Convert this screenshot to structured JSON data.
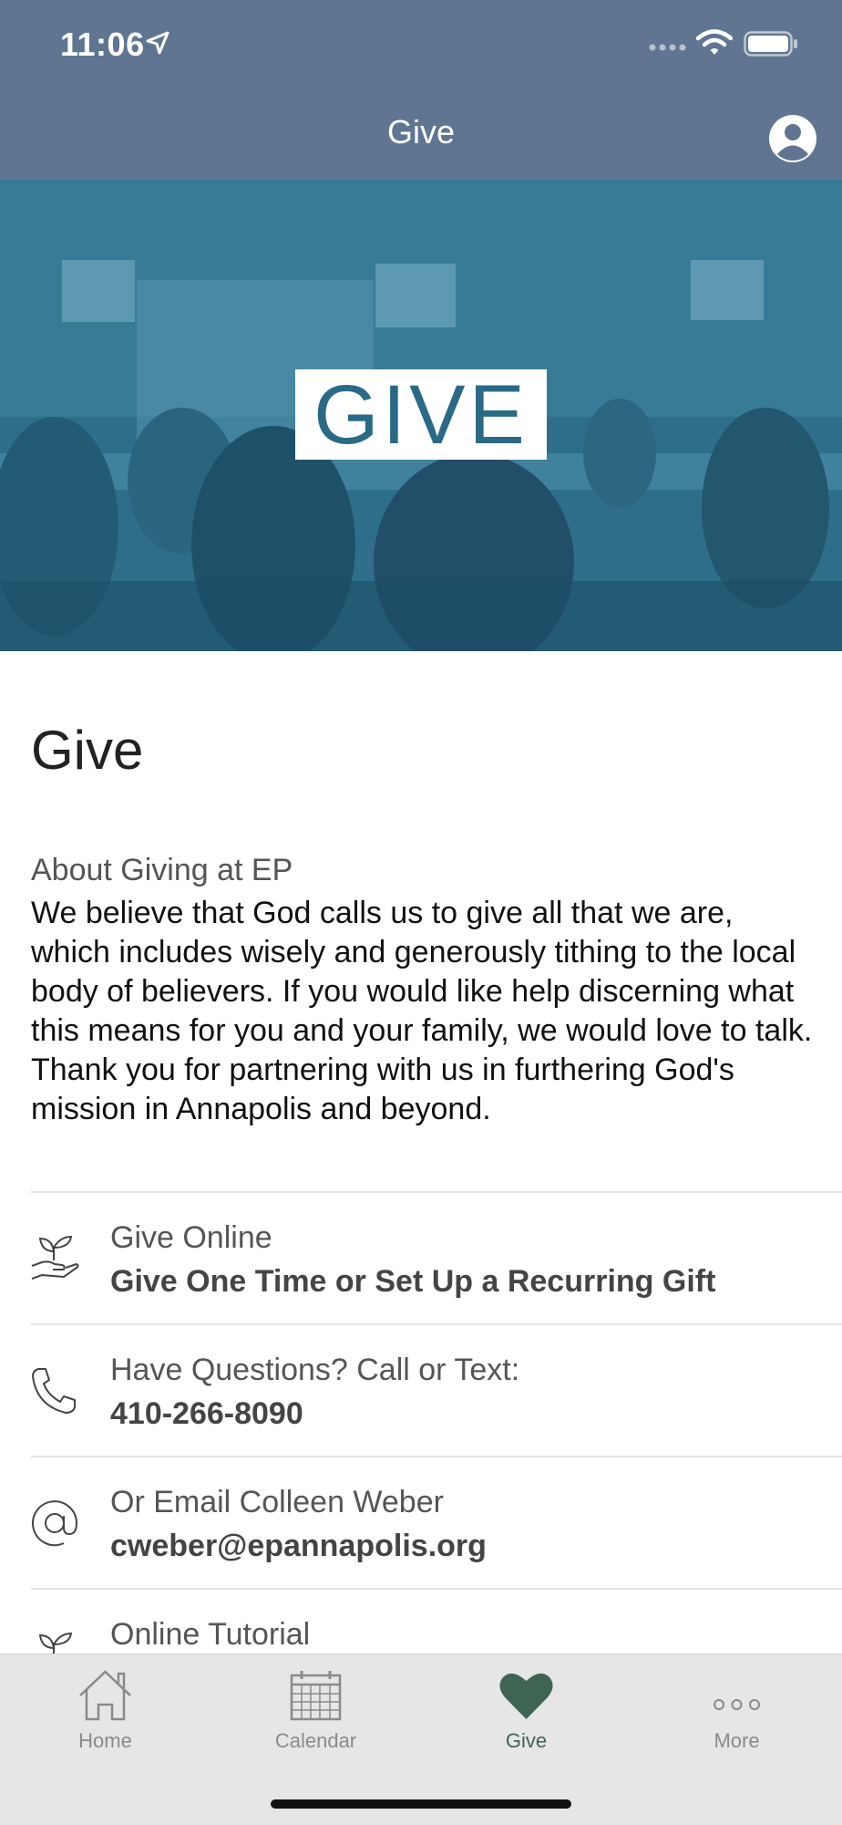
{
  "status_bar": {
    "time": "11:06"
  },
  "nav": {
    "title": "Give"
  },
  "hero": {
    "logo_text": "GIVE"
  },
  "page": {
    "title": "Give",
    "about_heading": "About Giving at EP",
    "about_body": "We believe that God calls us to give all that we are, which includes wisely and generously tithing to the local body of believers. If you would like help discerning what this means for you and your family, we would love to talk. Thank you for partnering with us in furthering God's mission in Annapolis and beyond."
  },
  "list": [
    {
      "title": "Give Online",
      "subtitle": "Give One Time or Set Up a Recurring Gift",
      "icon": "giving-hand-plant-icon"
    },
    {
      "title": "Have Questions? Call or Text:",
      "subtitle": "410-266-8090",
      "icon": "phone-icon"
    },
    {
      "title": "Or Email Colleen Weber",
      "subtitle": "cweber@epannapolis.org",
      "icon": "at-sign-icon"
    },
    {
      "title": "Online Tutorial",
      "subtitle": "",
      "icon": "giving-hand-plant-icon"
    }
  ],
  "tabs": [
    {
      "label": "Home",
      "icon": "home-icon",
      "active": false
    },
    {
      "label": "Calendar",
      "icon": "calendar-icon",
      "active": false
    },
    {
      "label": "Give",
      "icon": "heart-icon",
      "active": true
    },
    {
      "label": "More",
      "icon": "more-dots-icon",
      "active": false
    }
  ],
  "colors": {
    "nav_bar": "#5f7591",
    "hero_overlay": "#2c6a86",
    "active_tab": "#3f6454",
    "inactive_tab": "#8a8a8a"
  }
}
